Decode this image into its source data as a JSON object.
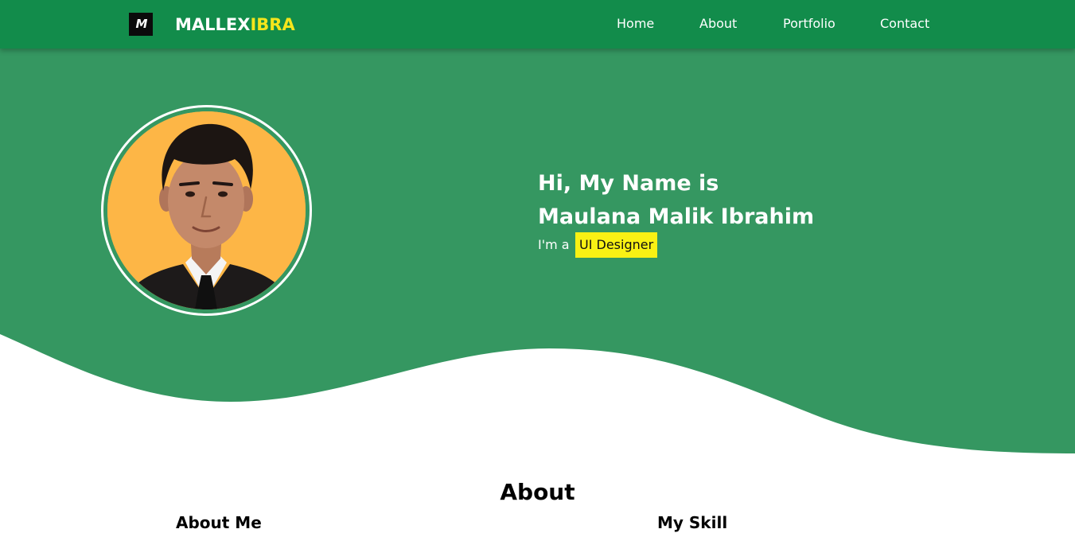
{
  "nav": {
    "logo_text": "M",
    "brand_first": "MALLEX",
    "brand_second": "IBRA",
    "links": [
      "Home",
      "About",
      "Portfolio",
      "Contact"
    ]
  },
  "hero": {
    "greeting": "Hi, My Name is",
    "name": "Maulana Malik Ibrahim",
    "role_prefix": "I'm a",
    "role": "UI Designer",
    "photo_alt": "Maulana Malik Ibrahim"
  },
  "about": {
    "title": "About",
    "about_me_heading": "About Me",
    "skill_heading": "My Skill"
  },
  "colors": {
    "navbar": "#128c4b",
    "hero": "#359761",
    "brand_accent": "#f5e51c",
    "badge": "#f9f114",
    "photo_bg": "#fdb646"
  }
}
